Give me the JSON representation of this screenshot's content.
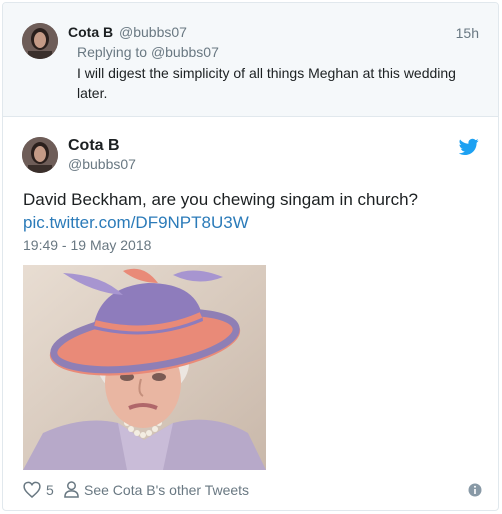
{
  "parent_tweet": {
    "display_name": "Cota B",
    "handle": "@bubbs07",
    "timestamp": "15h",
    "replying_prefix": "Replying to",
    "replying_handle": "@bubbs07",
    "text": "I will digest the simplicity of all things Meghan at this wedding later."
  },
  "main_tweet": {
    "display_name": "Cota B",
    "handle": "@bubbs07",
    "text": "David Beckham, are you chewing singam in church?",
    "link": "pic.twitter.com/DF9NPT8U3W",
    "datetime": "19:49 - 19 May 2018"
  },
  "footer": {
    "like_count": "5",
    "other_tweets_label": "See Cota B's other Tweets"
  },
  "icons": {
    "brand": "twitter-bird-icon",
    "like": "heart-icon",
    "profile": "person-icon",
    "info": "info-icon"
  },
  "colors": {
    "link": "#2b7bb9",
    "twitter_blue": "#1da1f2",
    "muted_text": "#697882",
    "parent_background": "#f5f8fa"
  }
}
